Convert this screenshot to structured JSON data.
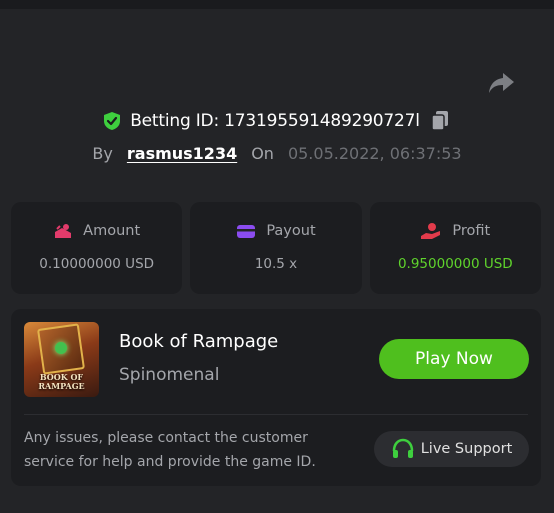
{
  "header": {
    "betting_id_text": "Betting ID: 173195591489290727l",
    "by_label": "By",
    "username": "rasmus1234",
    "on_label": "On",
    "datetime": "05.05.2022, 06:37:53"
  },
  "stats": [
    {
      "label": "Amount",
      "value": "0.10000000 USD",
      "icon": "amount-icon",
      "icon_color": "#e23b6b"
    },
    {
      "label": "Payout",
      "value": "10.5 x",
      "icon": "wallet-icon",
      "icon_color": "#8b4cf0"
    },
    {
      "label": "Profit",
      "value": "0.95000000 USD",
      "icon": "profit-icon",
      "icon_color": "#e23b4b",
      "value_color": "#5fd32c"
    }
  ],
  "game": {
    "title": "Book of Rampage",
    "provider": "Spinomenal",
    "thumbnail_text_line1": "BOOK OF",
    "thumbnail_text_line2": "RAMPAGE",
    "play_label": "Play Now"
  },
  "support": {
    "help_text": "Any issues, please contact the customer service for help and provide the game ID.",
    "button_label": "Live Support"
  },
  "colors": {
    "accent_green": "#4fbf1e",
    "verified_green": "#3ecf3e",
    "background": "#232427",
    "card": "#1c1d20"
  }
}
